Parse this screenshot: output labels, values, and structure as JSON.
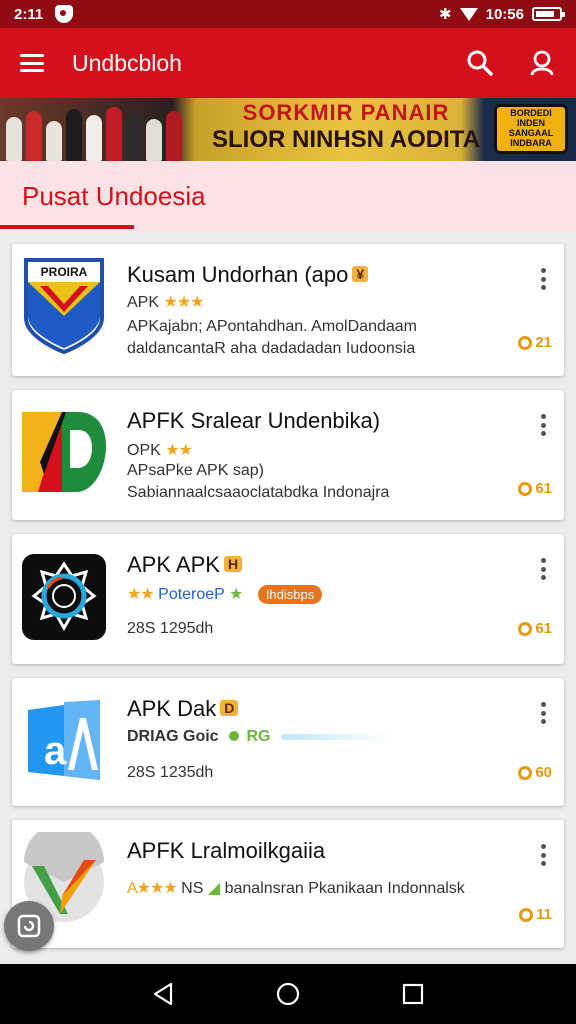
{
  "status_bar": {
    "time": "2:11",
    "battery_text": "10:56"
  },
  "app_bar": {
    "title": "Undbcbloh"
  },
  "banner": {
    "line1": "SORKMIR PANAIR",
    "line2": "SLIOR NINHSN AODITA",
    "badge_text": "BORDEDI INDEN SANGAAL INDBARA"
  },
  "section": {
    "title": "Pusat Undoesia"
  },
  "apps": [
    {
      "title": "Kusam Undorhan (apo",
      "badge": "¥",
      "line1": "APK",
      "stars": "★★★",
      "line2": "APKajabn; APontahdhan. AmolDandaam",
      "line3": "daldancantaR aha dadadadan Iudoonsia",
      "count": "21",
      "icon_text": "PROIRA"
    },
    {
      "title": "APFK Sralear Undenbika)",
      "line1": "OPK",
      "stars": "★★",
      "line2": "APsaPke APK sap)",
      "line3": "Sabiannaalcsaaoclatabdka Indonajra",
      "count": "61"
    },
    {
      "title": "APK APK",
      "badge": "H",
      "stars": "★★",
      "line1_blue": "PoteroeP",
      "star_green": "★",
      "pill": "Ihdisbps",
      "line2": "28S 1295dh",
      "count": "61"
    },
    {
      "title": "APK Dak",
      "badge": "D",
      "line1": "DRIAG Goic",
      "line1_green": "RG",
      "line2": "28S 1235dh",
      "count": "60"
    },
    {
      "title": "APFK Lralmoilkgaiia",
      "stars": "A★★★",
      "line1": "NS",
      "line1_rest": "banalnsran Pkanikaan Indonnalsk",
      "count": "11"
    }
  ]
}
